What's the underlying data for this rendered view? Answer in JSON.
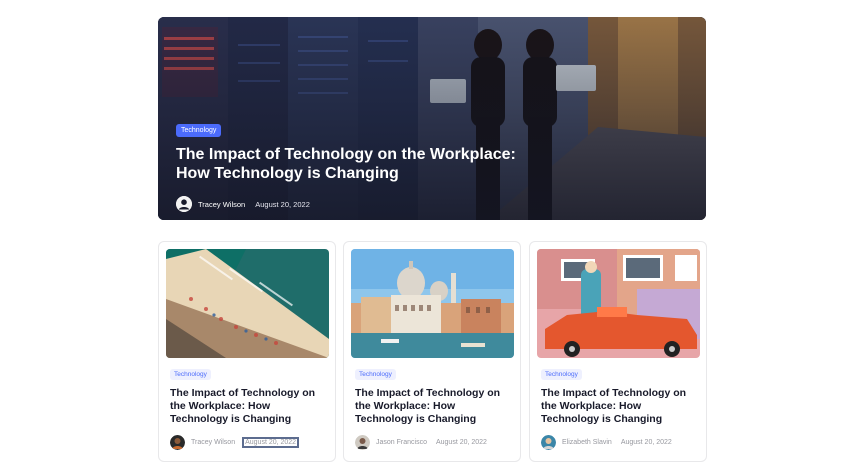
{
  "featured": {
    "category": "Technology",
    "title": "The Impact of Technology on the Workplace: How Technology is Changing",
    "author": "Tracey Wilson",
    "date": "August 20, 2022",
    "avatar_icon": "user-avatar-icon"
  },
  "posts": [
    {
      "category": "Technology",
      "title": "The Impact of Technology on the Workplace: How Technology is Changing",
      "author": "Tracey Wilson",
      "date": "August 20, 2022",
      "image": "beach-aerial-photo"
    },
    {
      "category": "Technology",
      "title": "The Impact of Technology on the Workplace: How Technology is Changing",
      "author": "Jason Francisco",
      "date": "August 20, 2022",
      "image": "venice-canal-photo"
    },
    {
      "category": "Technology",
      "title": "The Impact of Technology on the Workplace: How Technology is Changing",
      "author": "Elizabeth Slavin",
      "date": "August 20, 2022",
      "image": "woman-orange-car-photo"
    }
  ],
  "colors": {
    "accent": "#4b6bfb",
    "badge_bg": "#eef0fe",
    "meta_text": "#97989f",
    "title_text": "#181a2a"
  }
}
